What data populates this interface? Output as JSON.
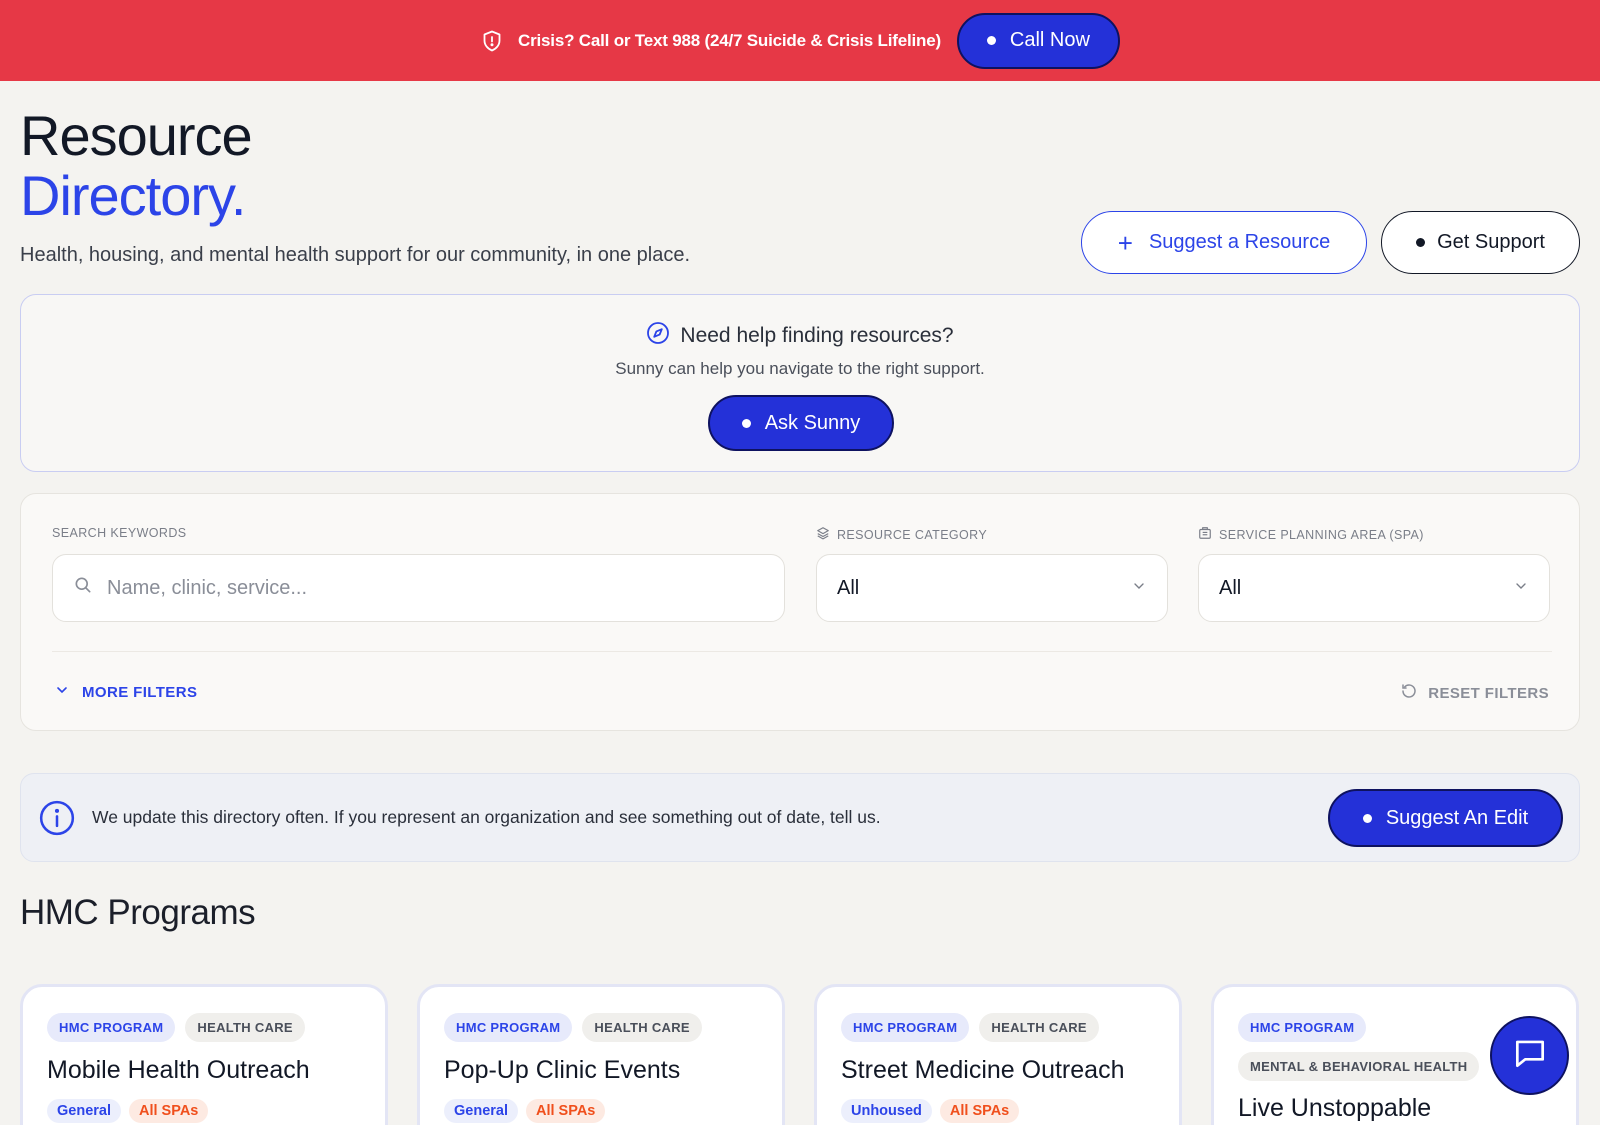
{
  "crisis": {
    "text": "Crisis? Call or Text 988 (24/7 Suicide & Crisis Lifeline)",
    "button": "Call Now",
    "background": "#e63846"
  },
  "header": {
    "title_line1": "Resource",
    "title_line2": "Directory.",
    "subtitle": "Health, housing, and mental health support for our community, in one place.",
    "suggest_resource": "Suggest a Resource",
    "get_support": "Get Support"
  },
  "sunny": {
    "heading": "Need help finding resources?",
    "subheading": "Sunny can help you navigate to the right support.",
    "button": "Ask Sunny",
    "icon": "compass-icon"
  },
  "filters": {
    "search_label": "SEARCH KEYWORDS",
    "search_placeholder": "Name, clinic, service...",
    "category_label": "RESOURCE CATEGORY",
    "category_value": "All",
    "spa_label": "SERVICE PLANNING AREA (SPA)",
    "spa_value": "All",
    "more_filters": "MORE FILTERS",
    "reset_filters": "RESET FILTERS"
  },
  "info": {
    "text": "We update this directory often. If you represent an organization and see something out of date, tell us.",
    "button": "Suggest An Edit"
  },
  "programs": {
    "title": "HMC Programs",
    "cards": [
      {
        "tags": [
          "HMC PROGRAM",
          "HEALTH CARE"
        ],
        "title": "Mobile Health Outreach",
        "chips": [
          "General",
          "All SPAs"
        ]
      },
      {
        "tags": [
          "HMC PROGRAM",
          "HEALTH CARE"
        ],
        "title": "Pop-Up Clinic Events",
        "chips": [
          "General",
          "All SPAs"
        ]
      },
      {
        "tags": [
          "HMC PROGRAM",
          "HEALTH CARE"
        ],
        "title": "Street Medicine Outreach",
        "chips": [
          "Unhoused",
          "All SPAs"
        ]
      },
      {
        "tags": [
          "HMC PROGRAM",
          "MENTAL & BEHAVIORAL HEALTH"
        ],
        "title": "Live Unstoppable",
        "chips": []
      }
    ]
  },
  "colors": {
    "accent": "#2c44e8",
    "button_blue": "#2431d8",
    "page_bg": "#f4f3f0"
  }
}
